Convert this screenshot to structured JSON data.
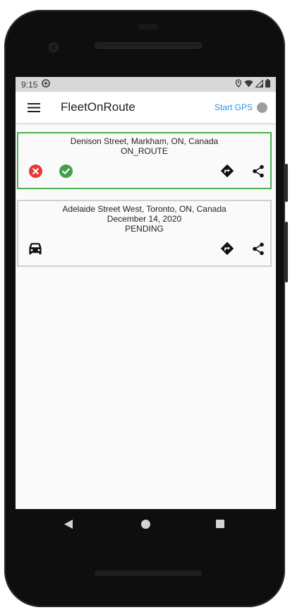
{
  "status": {
    "time": "9:15"
  },
  "appbar": {
    "title": "FleetOnRoute",
    "gps_label": "Start GPS"
  },
  "colors": {
    "accent": "#2196f3",
    "active_border": "#4caf50",
    "cancel": "#e53935",
    "confirm": "#43a047"
  },
  "deliveries": [
    {
      "address": "Denison Street, Markham, ON, Canada",
      "status": "ON_ROUTE"
    },
    {
      "address": "Adelaide Street West, Toronto, ON, Canada",
      "date": "December 14, 2020",
      "status": "PENDING"
    }
  ],
  "icons": {
    "status": [
      "vpn-icon",
      "location-icon",
      "wifi-icon",
      "signal-icon",
      "battery-icon"
    ],
    "card1": [
      "cancel-icon",
      "check-icon",
      "directions-icon",
      "share-icon"
    ],
    "card2": [
      "car-icon",
      "directions-icon",
      "share-icon"
    ],
    "navigation": [
      "back-icon",
      "home-icon",
      "recents-icon"
    ]
  }
}
